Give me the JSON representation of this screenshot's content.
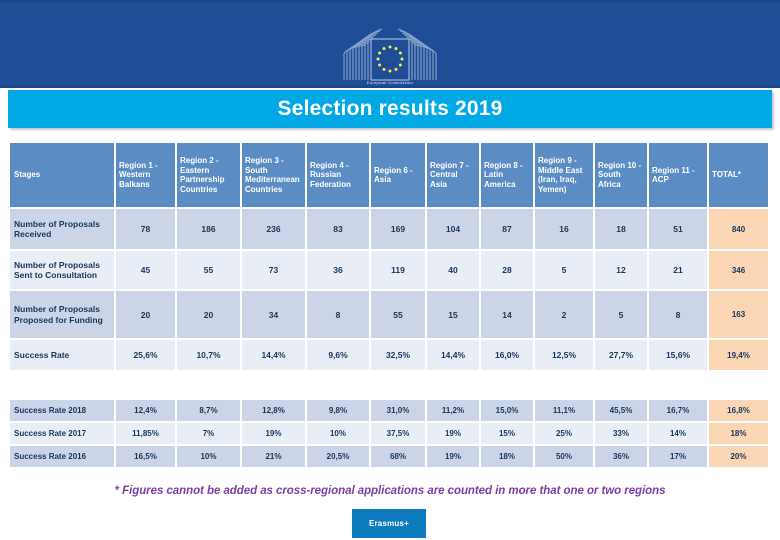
{
  "banner": {
    "logo_name": "european-commission-logo",
    "logo_caption": "European Commission"
  },
  "title": {
    "text": "Selection results 2019"
  },
  "table": {
    "columns": [
      "Stages",
      "Region 1 - Western Balkans",
      "Region 2 - Eastern Partnership Countries",
      "Region 3 - South Mediterranean Countries",
      "Region 4 - Russian Federation",
      "Region 6 - Asia",
      "Region 7 - Central Asia",
      "Region 8 - Latin America",
      "Region 9 - Middle East (Iran, Iraq, Yemen)",
      "Region 10 - South Africa",
      "Region 11 - ACP",
      "TOTAL*"
    ],
    "rows": [
      {
        "stage": "Number of Proposals Received",
        "values": [
          "78",
          "186",
          "236",
          "83",
          "169",
          "104",
          "87",
          "16",
          "18",
          "51"
        ],
        "total": "840"
      },
      {
        "stage": "Number of Proposals Sent to Consultation",
        "values": [
          "45",
          "55",
          "73",
          "36",
          "119",
          "40",
          "28",
          "5",
          "12",
          "21"
        ],
        "total": "346"
      },
      {
        "stage": "Number of Proposals Proposed for Funding",
        "values": [
          "20",
          "20",
          "34",
          "8",
          "55",
          "15",
          "14",
          "2",
          "5",
          "8"
        ],
        "total": "163"
      },
      {
        "stage": "Success Rate",
        "values": [
          "25,6%",
          "10,7%",
          "14,4%",
          "9,6%",
          "32,5%",
          "14,4%",
          "16,0%",
          "12,5%",
          "27,7%",
          "15,6%"
        ],
        "total": "19,4%"
      }
    ]
  },
  "history": {
    "rows": [
      {
        "stage": "Success Rate 2018",
        "values": [
          "12,4%",
          "8,7%",
          "12,8%",
          "9,8%",
          "31,0%",
          "11,2%",
          "15,0%",
          "11,1%",
          "45,5%",
          "16,7%"
        ],
        "total": "16,8%"
      },
      {
        "stage": "Success Rate 2017",
        "values": [
          "11,85%",
          "7%",
          "19%",
          "10%",
          "37,5%",
          "19%",
          "15%",
          "25%",
          "33%",
          "14%"
        ],
        "total": "18%"
      },
      {
        "stage": "Success Rate 2016",
        "values": [
          "16,5%",
          "10%",
          "21%",
          "20,5%",
          "68%",
          "19%",
          "18%",
          "50%",
          "36%",
          "17%"
        ],
        "total": "20%"
      }
    ]
  },
  "footnote": {
    "text": "* Figures cannot be added as cross-regional applications are counted in more that one or two regions"
  },
  "erasmus": {
    "label": "Erasmus+"
  },
  "colors": {
    "banner_blue": "#1f4e96",
    "title_cyan": "#00a8e6",
    "header_blue": "#5b8cc4",
    "row_dark": "#ccd5e8",
    "row_light": "#e8edf6",
    "total_peach": "#fad6b4",
    "footnote_purple": "#7a3fa0",
    "erasmus_blue": "#0f7bbf"
  }
}
